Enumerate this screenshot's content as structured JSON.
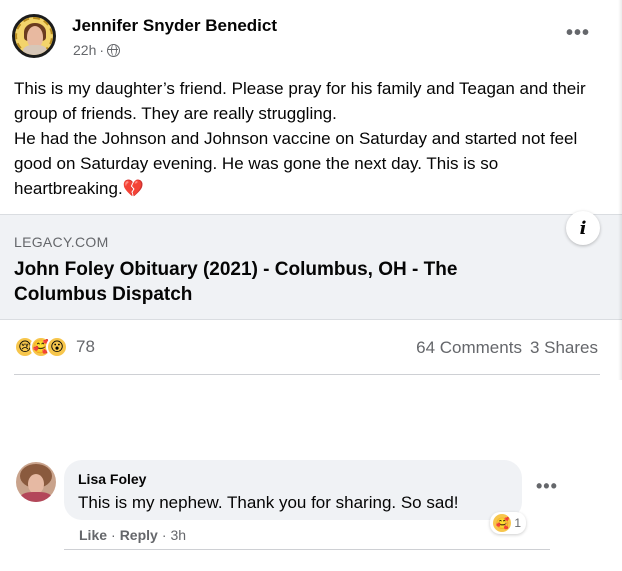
{
  "post": {
    "author": "Jennifer Snyder Benedict",
    "time": "22h",
    "separator": "·",
    "more_glyph": "•••",
    "text_lines": [
      "This is my daughter’s friend. Please pray for his family and Teagan and their group of friends. They are really struggling.",
      "He had the Johnson and Johnson vaccine on Saturday and started not feel good on Saturday evening. He was gone the next day. This is so heartbreaking.💔"
    ]
  },
  "link_preview": {
    "domain": "LEGACY.COM",
    "title": "John Foley Obituary (2021) - Columbus, OH - The Columbus Dispatch",
    "info_glyph": "i"
  },
  "engagement": {
    "reaction_icons": [
      "sad-reaction-icon",
      "care-reaction-icon",
      "wow-reaction-icon"
    ],
    "reaction_count": "78",
    "comments": "64 Comments",
    "shares": "3 Shares"
  },
  "comment": {
    "author": "Lisa Foley",
    "text": "This is my nephew. Thank you for sharing. So sad!",
    "reaction_count": "1",
    "like_label": "Like",
    "reply_label": "Reply",
    "time": "3h",
    "dot": "·",
    "more_glyph": "•••"
  }
}
